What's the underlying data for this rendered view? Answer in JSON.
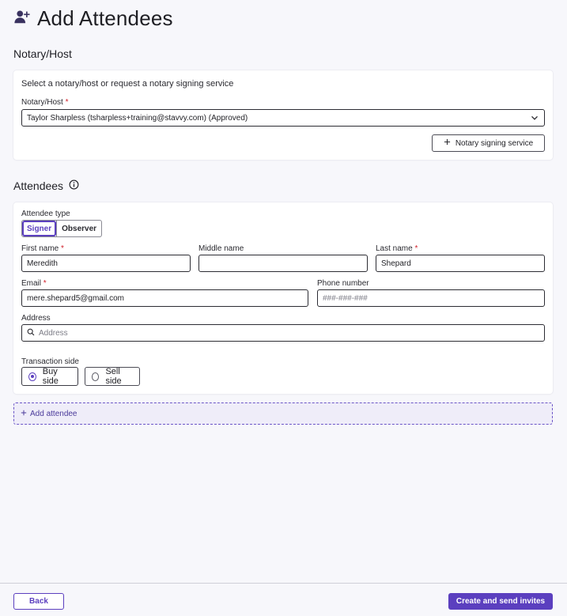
{
  "header": {
    "title": "Add Attendees",
    "icon": "add-person-icon"
  },
  "notary_section": {
    "heading": "Notary/Host",
    "instruction": "Select a notary/host or request a notary signing service",
    "field_label": "Notary/Host",
    "required_mark": "*",
    "selected_value": "Taylor Sharpless (tsharpless+training@stavvy.com) (Approved)",
    "service_button": "Notary signing service"
  },
  "attendees_section": {
    "heading": "Attendees",
    "info_icon": "info-icon",
    "attendee_type_label": "Attendee type",
    "attendee_types": [
      "Signer",
      "Observer"
    ],
    "selected_type": "Signer",
    "first_name_label": "First name",
    "first_name_value": "Meredith",
    "middle_name_label": "Middle name",
    "middle_name_value": "",
    "last_name_label": "Last name",
    "last_name_value": "Shepard",
    "email_label": "Email",
    "email_value": "mere.shepard5@gmail.com",
    "phone_label": "Phone number",
    "phone_placeholder": "###-###-###",
    "address_label": "Address",
    "address_placeholder": "Address",
    "transaction_side_label": "Transaction side",
    "transaction_sides": [
      "Buy side",
      "Sell side"
    ],
    "selected_side": "Buy side",
    "required_mark": "*"
  },
  "add_attendee_label": "Add attendee",
  "footer": {
    "back_label": "Back",
    "submit_label": "Create and send invites"
  },
  "colors": {
    "accent": "#5b3fbf",
    "required": "#d0202a",
    "background": "#f7f7fb"
  }
}
